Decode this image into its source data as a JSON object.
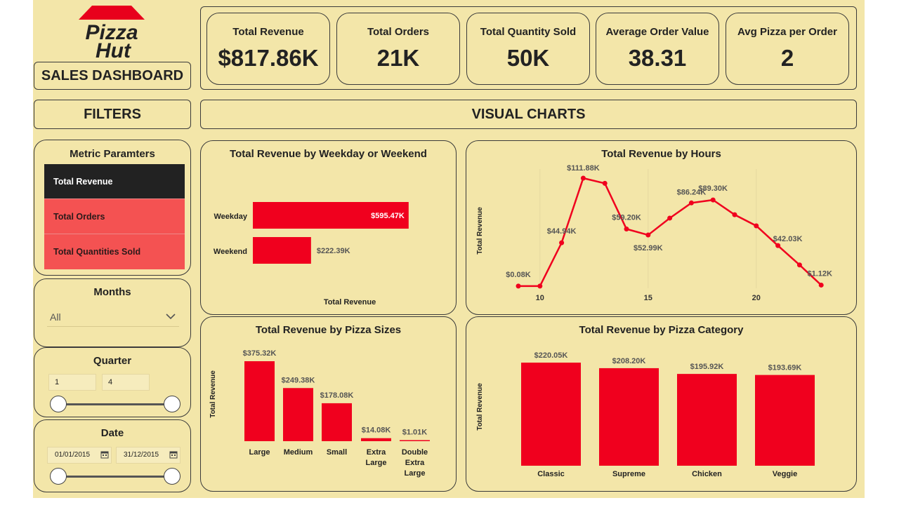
{
  "brand": {
    "logo_line1": "Pizza",
    "logo_line2": "Hut",
    "dashboard_title": "SALES DASHBOARD"
  },
  "kpis": [
    {
      "label": "Total Revenue",
      "value": "$817.86K"
    },
    {
      "label": "Total Orders",
      "value": "21K"
    },
    {
      "label": "Total Quantity Sold",
      "value": "50K"
    },
    {
      "label": "Average Order Value",
      "value": "38.31"
    },
    {
      "label": "Avg Pizza per Order",
      "value": "2"
    }
  ],
  "filters_header": "FILTERS",
  "charts_header": "VISUAL CHARTS",
  "metric_parameters": {
    "title": "Metric Paramters",
    "options": [
      "Total Revenue",
      "Total Orders",
      "Total Quantities Sold"
    ],
    "selected": "Total Revenue"
  },
  "months": {
    "label": "Months",
    "value": "All"
  },
  "quarter": {
    "label": "Quarter",
    "min": "1",
    "max": "4"
  },
  "date": {
    "label": "Date",
    "start": "01/01/2015",
    "end": "31/12/2015"
  },
  "colors": {
    "accent": "#f0001e",
    "selected": "#222222",
    "unselected": "#f45252",
    "background": "#f3e6a9"
  },
  "chart_data": [
    {
      "type": "bar",
      "orientation": "horizontal",
      "title": "Total Revenue by Weekday or Weekend",
      "xlabel": "Total Revenue",
      "categories": [
        "Weekday",
        "Weekend"
      ],
      "values": [
        595.47,
        222.39
      ],
      "labels": [
        "$595.47K",
        "$222.39K"
      ]
    },
    {
      "type": "line",
      "title": "Total Revenue by Hours",
      "ylabel": "Total Revenue",
      "x": [
        9,
        10,
        11,
        12,
        13,
        14,
        15,
        16,
        17,
        18,
        19,
        20,
        21,
        22,
        23
      ],
      "y": [
        0.08,
        0.08,
        44.94,
        111.88,
        106.5,
        59.2,
        52.99,
        70.5,
        86.24,
        89.3,
        74.0,
        62.5,
        42.03,
        22.0,
        1.12
      ],
      "point_labels": {
        "0": "$0.08K",
        "2": "$44.94K",
        "3": "$111.88K",
        "5": "$59.20K",
        "6": "$52.99K",
        "8": "$86.24K",
        "9": "$89.30K",
        "12": "$42.03K",
        "14": "$1.12K"
      },
      "xticks": [
        10,
        15,
        20
      ],
      "grid": false
    },
    {
      "type": "bar",
      "title": "Total Revenue by Pizza Sizes",
      "ylabel": "Total Revenue",
      "categories": [
        "Large",
        "Medium",
        "Small",
        "Extra Large",
        "Double Extra Large"
      ],
      "values": [
        375.32,
        249.38,
        178.08,
        14.08,
        1.01
      ],
      "labels": [
        "$375.32K",
        "$249.38K",
        "$178.08K",
        "$14.08K",
        "$1.01K"
      ]
    },
    {
      "type": "bar",
      "title": "Total Revenue by Pizza Category",
      "ylabel": "Total Revenue",
      "categories": [
        "Classic",
        "Supreme",
        "Chicken",
        "Veggie"
      ],
      "values": [
        220.05,
        208.2,
        195.92,
        193.69
      ],
      "labels": [
        "$220.05K",
        "$208.20K",
        "$195.92K",
        "$193.69K"
      ]
    }
  ]
}
